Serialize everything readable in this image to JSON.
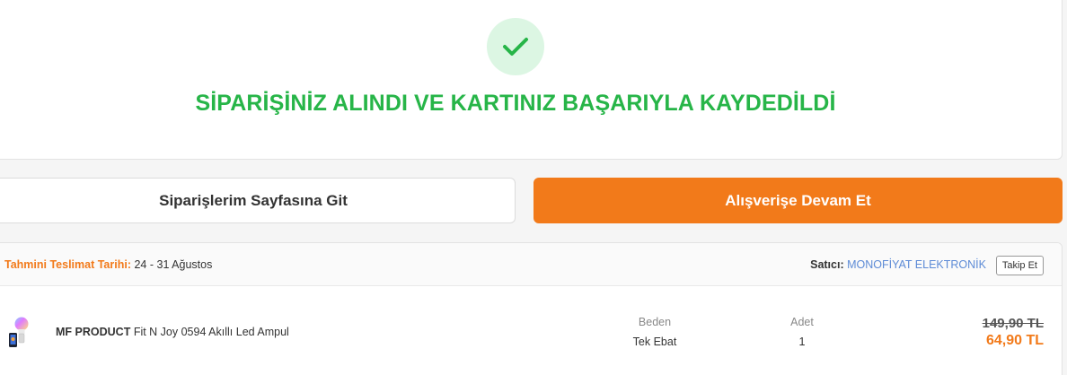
{
  "success": {
    "title": "SİPARİŞİNİZ ALINDI VE KARTINIZ BAŞARIYLA KAYDEDİLDİ",
    "icon": "check-icon"
  },
  "actions": {
    "orders_label": "Siparişlerim Sayfasına Git",
    "continue_label": "Alışverişe Devam Et"
  },
  "order": {
    "delivery_label": "Tahmini Teslimat Tarihi:",
    "delivery_value": "24 - 31 Ağustos",
    "seller_label": "Satıcı:",
    "seller_name": "MONOFİYAT ELEKTRONİK",
    "follow_label": "Takip Et",
    "product": {
      "brand": "MF PRODUCT",
      "name": "Fit N Joy 0594 Akıllı Led Ampul",
      "size_header": "Beden",
      "size_value": "Tek Ebat",
      "qty_header": "Adet",
      "qty_value": "1",
      "old_price": "149,90 TL",
      "new_price": "64,90 TL"
    }
  },
  "colors": {
    "success_green": "#27b548",
    "brand_orange": "#f27a1a",
    "seller_link": "#5d8bd6"
  }
}
